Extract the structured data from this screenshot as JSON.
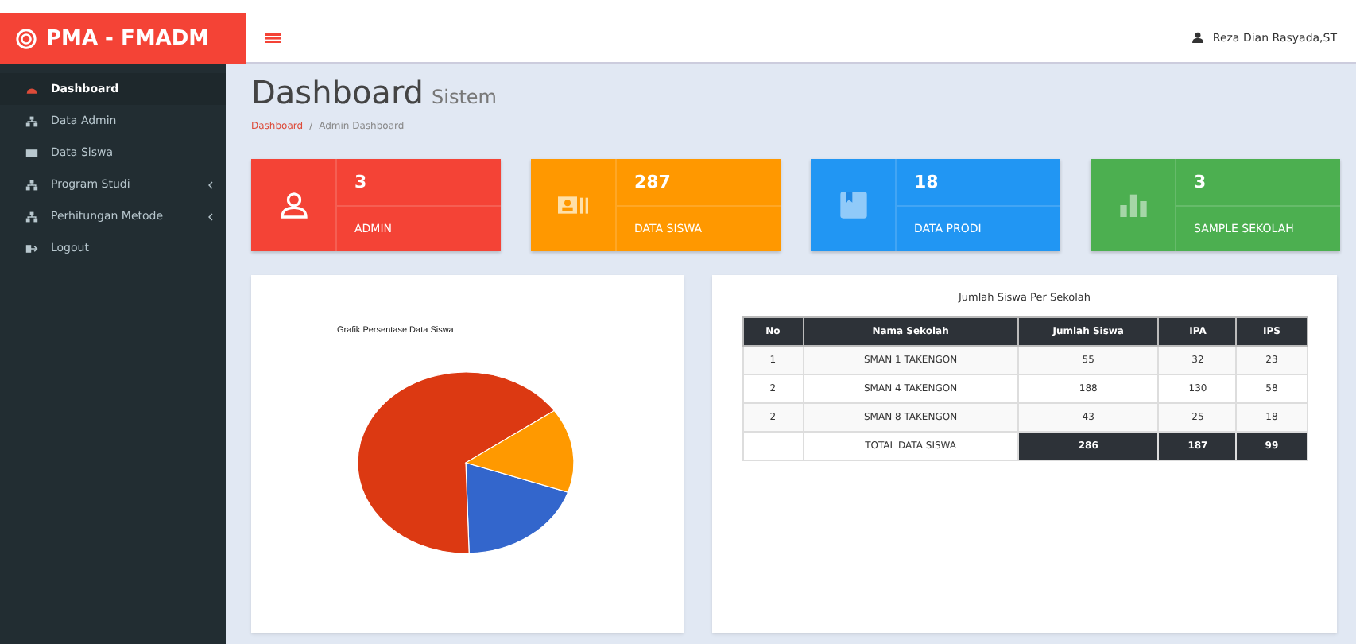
{
  "brand": "PMA - FMADM",
  "user": {
    "name": "Reza Dian Rasyada,ST"
  },
  "sidebar": {
    "items": [
      {
        "label": "Dashboard",
        "kind": "dashboard",
        "selected": true,
        "has_submenu": false
      },
      {
        "label": "Data Admin",
        "kind": "sitemap",
        "selected": false,
        "has_submenu": false
      },
      {
        "label": "Data Siswa",
        "kind": "list",
        "selected": false,
        "has_submenu": false
      },
      {
        "label": "Program Studi",
        "kind": "sitemap",
        "selected": false,
        "has_submenu": true
      },
      {
        "label": "Perhitungan Metode",
        "kind": "sitemap",
        "selected": false,
        "has_submenu": true
      },
      {
        "label": "Logout",
        "kind": "logout",
        "selected": false,
        "has_submenu": false
      }
    ]
  },
  "page": {
    "title": "Dashboard",
    "subtitle": "Sistem",
    "breadcrumb": [
      "Dashboard",
      "/",
      "Admin Dashboard"
    ]
  },
  "stats": [
    {
      "value": "3",
      "label": "ADMIN",
      "kind": "user",
      "color": "#f44336"
    },
    {
      "value": "287",
      "label": "DATA SISWA",
      "kind": "card",
      "color": "#ff9800"
    },
    {
      "value": "18",
      "label": "DATA PRODI",
      "kind": "book",
      "color": "#2196f3"
    },
    {
      "value": "3",
      "label": "SAMPLE SEKOLAH",
      "kind": "bars",
      "color": "#4caf50"
    }
  ],
  "chart_panel": {
    "title": "Grafik Persentase Data Siswa"
  },
  "table_panel": {
    "title": "Jumlah Siswa Per Sekolah",
    "columns": [
      "No",
      "Nama Sekolah",
      "Jumlah Siswa",
      "IPA",
      "IPS"
    ],
    "rows": [
      [
        "1",
        "SMAN 1 TAKENGON",
        "55",
        "32",
        "23"
      ],
      [
        "2",
        "SMAN 4 TAKENGON",
        "188",
        "130",
        "58"
      ],
      [
        "2",
        "SMAN 8 TAKENGON",
        "43",
        "25",
        "18"
      ]
    ],
    "total": {
      "label": "TOTAL DATA SISWA",
      "values": [
        "286",
        "187",
        "99"
      ]
    }
  }
}
